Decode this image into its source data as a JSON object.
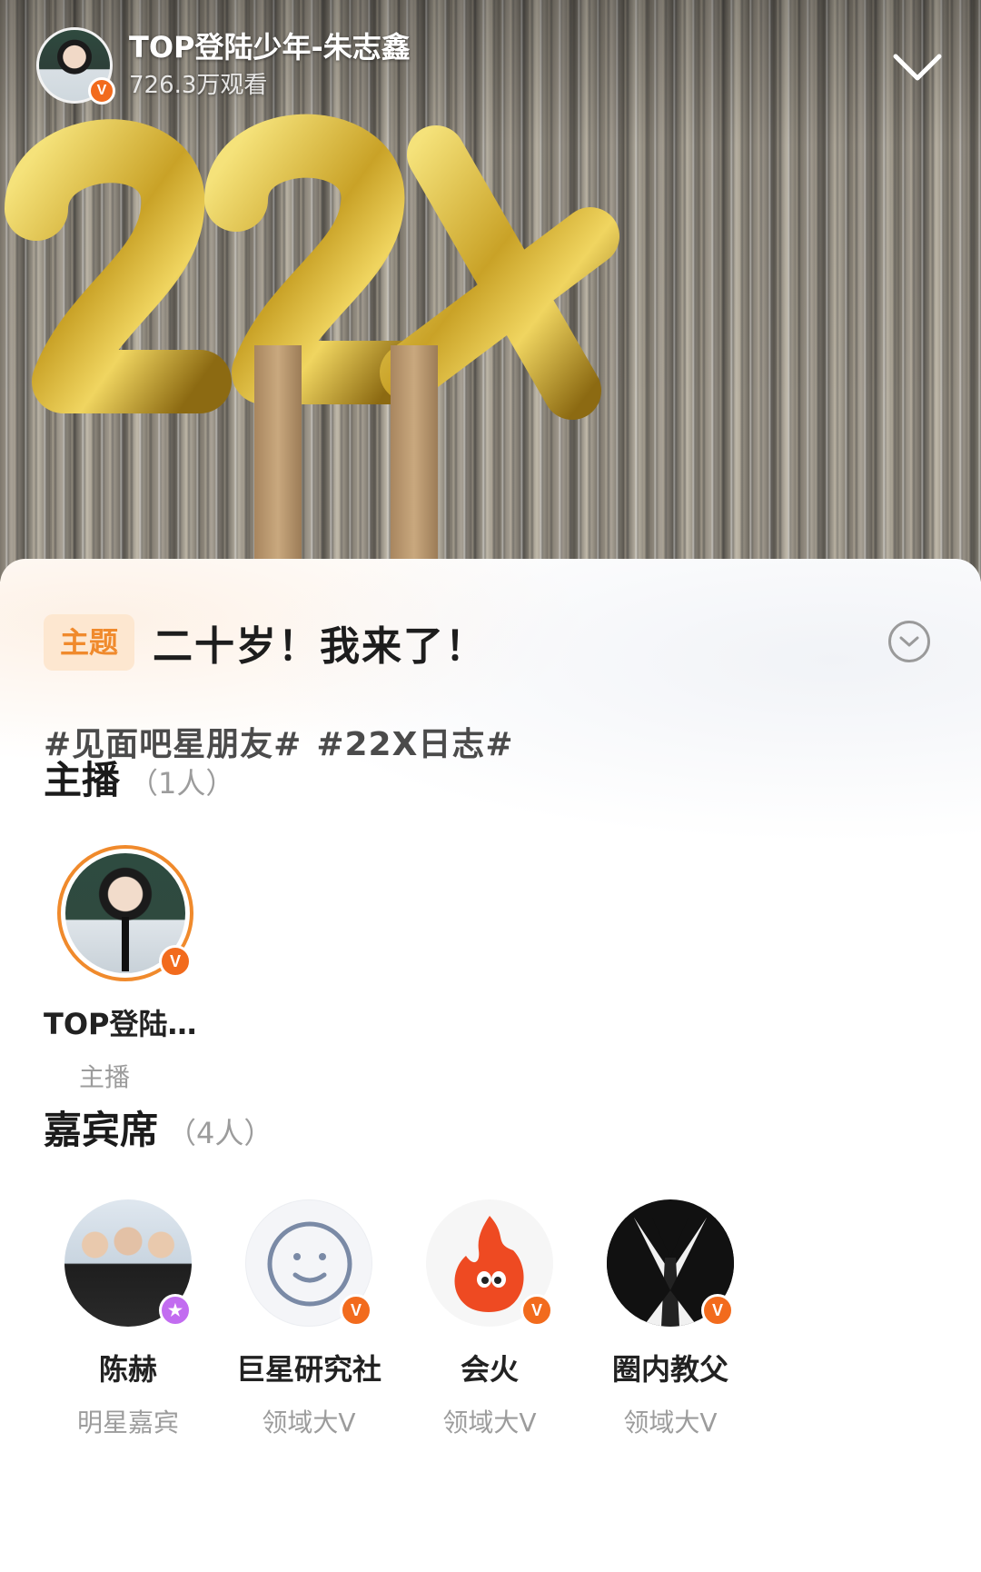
{
  "header": {
    "host_name": "TOP登陆少年-朱志鑫",
    "view_count": "726.3万观看",
    "verified_badge": "V",
    "collapse_icon": "chevron-down-icon"
  },
  "topic": {
    "tag_label": "主题",
    "title": "二十岁！我来了！",
    "expand_icon": "chevron-down-circle-icon"
  },
  "hashtags": [
    "#见面吧星朋友#",
    "#22X日志#"
  ],
  "host_section": {
    "title": "主播",
    "count": "（1人）",
    "hosts": [
      {
        "name": "TOP登陆…",
        "role": "主播",
        "badge": "V"
      }
    ]
  },
  "guest_section": {
    "title": "嘉宾席",
    "count": "（4人）",
    "guests": [
      {
        "name": "陈赫",
        "role": "明星嘉宾",
        "badge": "star"
      },
      {
        "name": "巨星研究社",
        "role": "领域大V",
        "badge": "V"
      },
      {
        "name": "会火",
        "role": "领域大V",
        "badge": "V"
      },
      {
        "name": "圈内教父",
        "role": "领域大V",
        "badge": "V"
      }
    ]
  },
  "colors": {
    "accent_orange": "#f08a2c",
    "verified_orange": "#f26b1d",
    "star_purple": "#c26cf0",
    "tag_background": "#fde7d0"
  }
}
